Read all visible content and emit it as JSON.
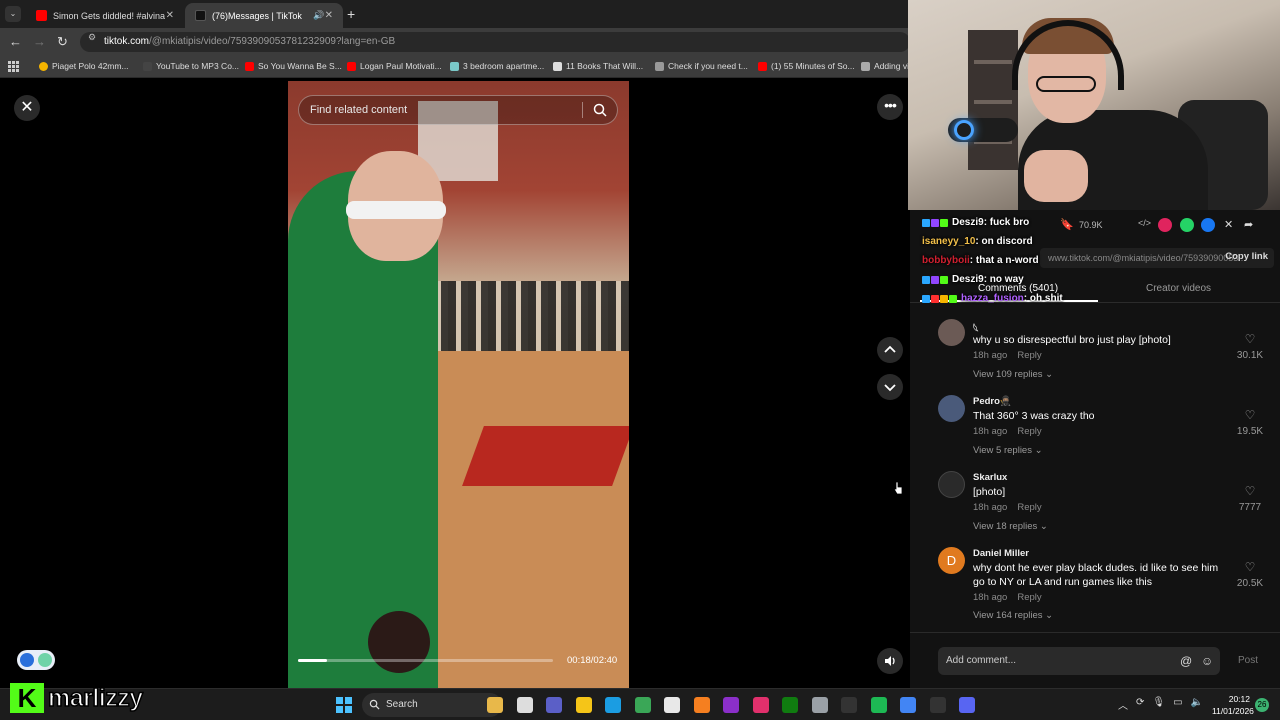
{
  "browser": {
    "tabs": [
      {
        "title": "Simon Gets diddled! #alvinandt",
        "color": "#ff0000"
      },
      {
        "title": "(76)Messages | TikTok",
        "color": "#111111"
      }
    ],
    "url_host": "tiktok.com",
    "url_path": "/@mkiatipis/video/7593909053781232909?lang=en-GB",
    "bookmarks": [
      {
        "label": "Piaget Polo 42mm...",
        "color": "#f5b400"
      },
      {
        "label": "YouTube to MP3 Co...",
        "color": "#444444"
      },
      {
        "label": "So You Wanna Be S...",
        "color": "#ff0000"
      },
      {
        "label": "Logan Paul Motivati...",
        "color": "#ff0000"
      },
      {
        "label": "3 bedroom apartme...",
        "color": "#7ac8c8"
      },
      {
        "label": "11 Books That Will...",
        "color": "#dddddd"
      },
      {
        "label": "Check if you need t...",
        "color": "#999999"
      },
      {
        "label": "(1) 55 Minutes of So...",
        "color": "#ff0000"
      },
      {
        "label": "Adding vi",
        "color": "#aaaaaa"
      }
    ]
  },
  "video": {
    "search_placeholder": "Find related content",
    "time": "00:18/02:40",
    "progress": 0.1125
  },
  "panel": {
    "saves": "70.9K",
    "link": "www.tiktok.com/@mkiatipis/video/75939090053...",
    "copy_link": "Copy link",
    "tab_comments": "Comments (5401)",
    "tab_creator": "Creator videos"
  },
  "chat": [
    {
      "user": "Deszi9",
      "text": " : fuck bro",
      "color": "#ffffff",
      "badges": [
        "#2aa7ff",
        "#9146ff",
        "#53fc18"
      ]
    },
    {
      "user": "isaneyy_10",
      "text": " : on discord",
      "color": "#f3c04a",
      "badges": []
    },
    {
      "user": "bobbyboii",
      "text": " : that a n-word",
      "color": "#d02030",
      "badges": []
    },
    {
      "user": "Deszi9",
      "text": " : no way",
      "color": "#ffffff",
      "badges": [
        "#2aa7ff",
        "#9146ff",
        "#53fc18"
      ]
    },
    {
      "user": "hazza_fusion",
      "text": " : oh shit",
      "color": "#b060ff",
      "badges": [
        "#2aa7ff",
        "#ff3030",
        "#f5b400",
        "#53fc18"
      ]
    }
  ],
  "comments": [
    {
      "user": "𓆩",
      "text": "why u so disrespectful bro just play [photo]",
      "time": "18h ago",
      "reply": "Reply",
      "likes": "30.1K",
      "replies": "View 109 replies",
      "avatar_color": "#6b5a55",
      "avatar_letter": ""
    },
    {
      "user": "Pedro🥷🏽",
      "text": "That 360° 3 was crazy tho",
      "time": "18h ago",
      "reply": "Reply",
      "likes": "19.5K",
      "replies": "View 5 replies",
      "avatar_color": "#4a5a7a",
      "avatar_letter": ""
    },
    {
      "user": "Skarlux",
      "text": "[photo]",
      "time": "18h ago",
      "reply": "Reply",
      "likes": "7777",
      "replies": "View 18 replies",
      "avatar_color": "#2a2a2a",
      "avatar_letter": ""
    },
    {
      "user": "Daniel Miller",
      "text": "why dont he ever play black dudes. id like to see him go to NY or LA and run games like this",
      "time": "18h ago",
      "reply": "Reply",
      "likes": "20.5K",
      "replies": "View 164 replies",
      "avatar_color": "#e07a1f",
      "avatar_letter": "D"
    }
  ],
  "compose": {
    "placeholder": "Add comment...",
    "post": "Post"
  },
  "stream": {
    "logo_text": "marlizzy",
    "logo_letter": "K"
  },
  "taskbar": {
    "search": "Search",
    "time": "20:12",
    "date": "11/01/2026",
    "notif": "26",
    "apps": [
      "#e8b84a",
      "#dddddd",
      "#5b5fc7",
      "#f5c518",
      "#1b9de2",
      "#3aa757",
      "#e8e8e8",
      "#f57f20",
      "#8b2fc9",
      "#e1306c",
      "#107c10",
      "#9aa0a6",
      "#333333",
      "#1db954",
      "#4285f4",
      "#333333",
      "#5865f2"
    ]
  }
}
